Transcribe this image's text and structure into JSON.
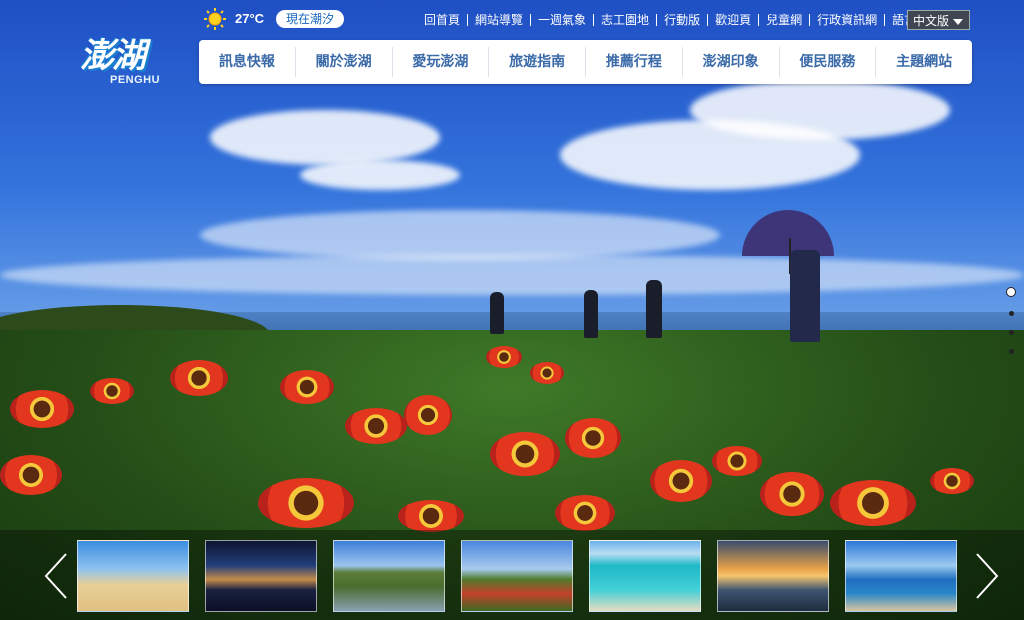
{
  "logo": {
    "main": "澎湖",
    "sub": "PENGHU"
  },
  "weather": {
    "temperature": "27°C",
    "icon": "sun-icon"
  },
  "tide_button": "現在潮汐",
  "top_links": [
    "回首頁",
    "網站導覽",
    "一週氣象",
    "志工園地",
    "行動版",
    "歡迎頁",
    "兒童網",
    "行政資訊網",
    "語言"
  ],
  "language_select": {
    "value": "中文版"
  },
  "nav": [
    "訊息快報",
    "關於澎湖",
    "愛玩澎湖",
    "旅遊指南",
    "推薦行程",
    "澎湖印象",
    "便民服務",
    "主題網站"
  ],
  "slider": {
    "active_index": 0,
    "count": 4
  },
  "thumbnails": [
    {
      "name": "beach-umbrellas"
    },
    {
      "name": "night-harbor"
    },
    {
      "name": "basalt-mesa"
    },
    {
      "name": "flower-field"
    },
    {
      "name": "turquoise-sea"
    },
    {
      "name": "sunset-coast"
    },
    {
      "name": "pier-beach"
    }
  ],
  "colors": {
    "nav_text": "#3a6aa8",
    "tide_text": "#1565c0"
  }
}
